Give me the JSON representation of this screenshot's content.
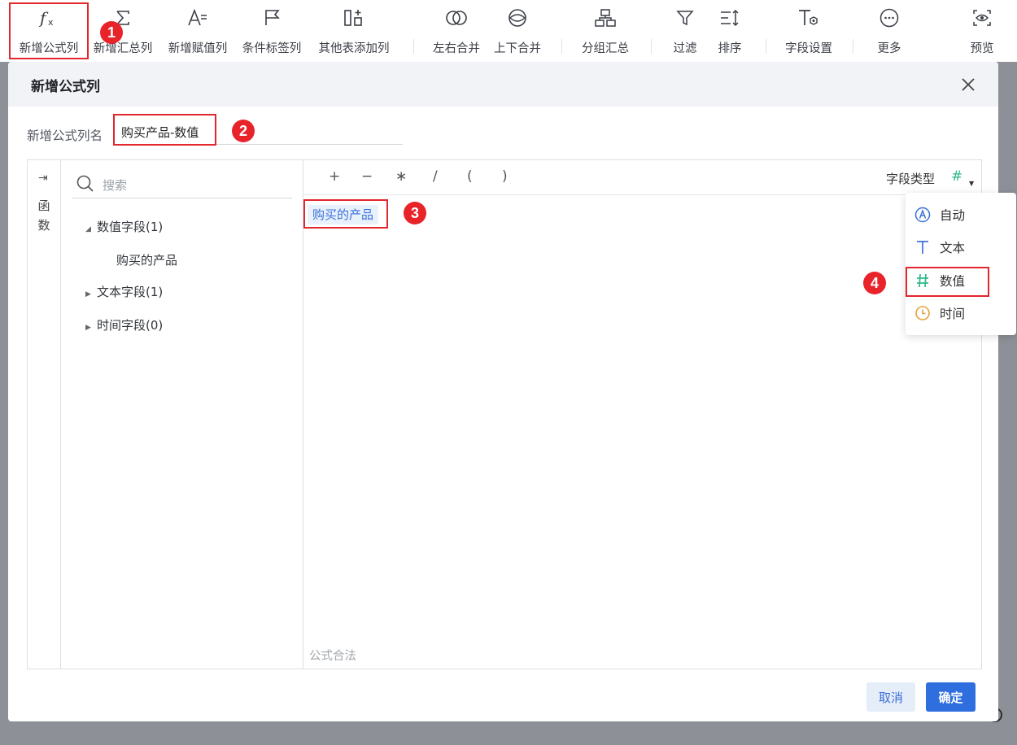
{
  "toolbar": {
    "items": [
      {
        "label": "新增公式列",
        "icon": "function-icon"
      },
      {
        "label": "新增汇总列",
        "icon": "sigma-icon"
      },
      {
        "label": "新增赋值列",
        "icon": "assign-icon"
      },
      {
        "label": "条件标签列",
        "icon": "flag-icon"
      },
      {
        "label": "其他表添加列",
        "icon": "add-column-icon"
      },
      {
        "label": "左右合并",
        "icon": "merge-horizontal-icon"
      },
      {
        "label": "上下合并",
        "icon": "merge-vertical-icon"
      },
      {
        "label": "分组汇总",
        "icon": "group-icon"
      },
      {
        "label": "过滤",
        "icon": "filter-icon"
      },
      {
        "label": "排序",
        "icon": "sort-icon"
      },
      {
        "label": "字段设置",
        "icon": "field-settings-icon"
      },
      {
        "label": "更多",
        "icon": "more-icon"
      },
      {
        "label": "预览",
        "icon": "preview-icon"
      }
    ]
  },
  "markers": [
    "1",
    "2",
    "3",
    "4"
  ],
  "dialog": {
    "title": "新增公式列",
    "name_label": "新增公式列名",
    "name_value": "购买产品-数值",
    "function_toggle": "⇥",
    "function_label": "函数",
    "search_placeholder": "搜索",
    "tree": [
      {
        "label": "数值字段(1)",
        "expanded": true,
        "children": [
          "购买的产品"
        ]
      },
      {
        "label": "文本字段(1)",
        "expanded": false,
        "children": []
      },
      {
        "label": "时间字段(0)",
        "expanded": false,
        "children": []
      }
    ],
    "operators": [
      "+",
      "−",
      "∗",
      "/",
      "(",
      ")"
    ],
    "field_type_label": "字段类型",
    "field_type_icon": "#",
    "formula_token": "购买的产品",
    "status": "公式合法",
    "type_options": [
      {
        "label": "自动",
        "icon": "auto-icon",
        "color": "#3b72d8"
      },
      {
        "label": "文本",
        "icon": "text-type-icon",
        "color": "#3b72d8"
      },
      {
        "label": "数值",
        "icon": "number-type-icon",
        "color": "#2fb88b"
      },
      {
        "label": "时间",
        "icon": "clock-icon",
        "color": "#e6a23c"
      }
    ],
    "cancel_label": "取消",
    "ok_label": "确定"
  },
  "colors": {
    "accent": "#2f6ede",
    "highlight": "#e2262d",
    "number": "#2fb88b"
  }
}
